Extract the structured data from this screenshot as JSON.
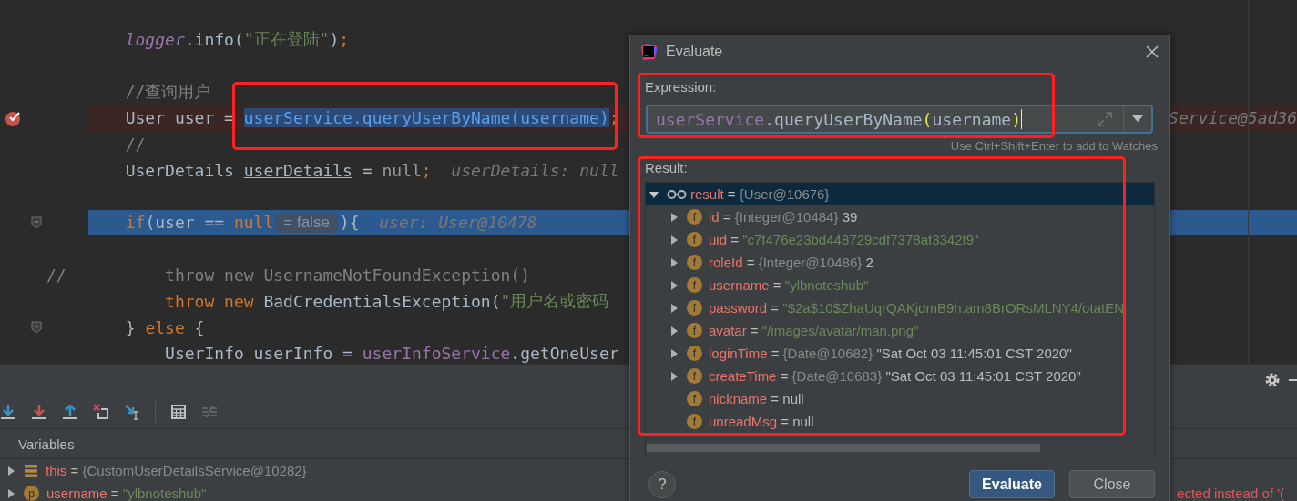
{
  "editor": {
    "lines": [
      {
        "kind": "normal",
        "segments": [
          {
            "kind": "static",
            "text": "        logger"
          },
          {
            "kind": "plain",
            "text": ".info("
          },
          {
            "kind": "string",
            "text": "\"正在登陆\""
          },
          {
            "kind": "plain",
            "text": ")"
          },
          {
            "kind": "punct",
            "text": ";"
          }
        ]
      },
      {
        "kind": "blank"
      },
      {
        "kind": "normal",
        "segments": [
          {
            "kind": "comment",
            "text": "        //查询用户"
          }
        ]
      },
      {
        "kind": "breakpoint",
        "segments": [
          {
            "kind": "plain",
            "text": "        User user = "
          },
          {
            "kind": "selection",
            "text": "userService.queryUserByName(username)",
            "annotated": true
          },
          {
            "kind": "punct",
            "text": ";"
          },
          {
            "kind": "tail",
            "text": "Service@5ad36"
          }
        ]
      },
      {
        "kind": "normal",
        "segments": [
          {
            "kind": "comment",
            "text": "        //"
          }
        ]
      },
      {
        "kind": "normal",
        "segments": [
          {
            "kind": "plain",
            "text": "        UserDetails "
          },
          {
            "kind": "local",
            "text": "userDetails"
          },
          {
            "kind": "plain",
            "text": " = "
          },
          {
            "kind": "nullval",
            "text": "null"
          },
          {
            "kind": "punct",
            "text": ";"
          },
          {
            "kind": "hint",
            "text": "  userDetails: null"
          }
        ]
      },
      {
        "kind": "blank"
      },
      {
        "kind": "current",
        "fold": true,
        "segments": [
          {
            "kind": "keyword",
            "text": "        if"
          },
          {
            "kind": "plain",
            "text": "(user == "
          },
          {
            "kind": "keyword",
            "text": "null"
          },
          {
            "kind": "chip",
            "text": "= false"
          },
          {
            "kind": "plain",
            "text": "){"
          },
          {
            "kind": "hint",
            "text": "  user: User@10478"
          }
        ]
      },
      {
        "kind": "blank"
      },
      {
        "kind": "normal",
        "segments": [
          {
            "kind": "comment",
            "text": "//          throw new UsernameNotFoundException()"
          }
        ]
      },
      {
        "kind": "normal",
        "segments": [
          {
            "kind": "keyword",
            "text": "            throw new"
          },
          {
            "kind": "plain",
            "text": " BadCredentialsException("
          },
          {
            "kind": "string",
            "text": "\"用户名或密码"
          }
        ]
      },
      {
        "kind": "normal",
        "fold": true,
        "segments": [
          {
            "kind": "plain",
            "text": "        } "
          },
          {
            "kind": "keyword",
            "text": "else"
          },
          {
            "kind": "plain",
            "text": " {"
          }
        ]
      },
      {
        "kind": "normal",
        "segments": [
          {
            "kind": "plain",
            "text": "            UserInfo userInfo = "
          },
          {
            "kind": "field",
            "text": "userInfoService"
          },
          {
            "kind": "plain",
            "text": ".getOneUser"
          }
        ]
      }
    ]
  },
  "dialog": {
    "title": "Evaluate",
    "expression_label": "Expression:",
    "expression": [
      {
        "kind": "field",
        "text": "userService"
      },
      {
        "kind": "plain",
        "text": ".queryUserByName"
      },
      {
        "kind": "paren",
        "text": "("
      },
      {
        "kind": "plain",
        "text": "username"
      },
      {
        "kind": "paren",
        "text": ")"
      }
    ],
    "expression_annotated": true,
    "hint": "Use Ctrl+Shift+Enter to add to Watches",
    "result_label": "Result:",
    "result_annotated": true,
    "result": {
      "name": "result",
      "op": "=",
      "value": "{User@10676}",
      "expanded": true,
      "selected": true,
      "children": [
        {
          "kind": "plain",
          "badge": "f",
          "name": "id",
          "op": "=",
          "type": "{Integer@10484}",
          "value": "39",
          "expandable": true
        },
        {
          "kind": "string",
          "badge": "f",
          "name": "uid",
          "op": "=",
          "value": "\"c7f476e23bd448729cdf7378af3342f9\"",
          "expandable": true
        },
        {
          "kind": "plain",
          "badge": "f",
          "name": "roleId",
          "op": "=",
          "type": "{Integer@10486}",
          "value": "2",
          "expandable": true
        },
        {
          "kind": "string",
          "badge": "f",
          "name": "username",
          "op": "=",
          "value": "\"ylbnoteshub\"",
          "expandable": true
        },
        {
          "kind": "string",
          "badge": "f",
          "name": "password",
          "op": "=",
          "value": "\"$2a$10$ZhaUqrQAKjdmB9h.am8BrORsMLNY4/otatEN",
          "expandable": true
        },
        {
          "kind": "string",
          "badge": "f",
          "name": "avatar",
          "op": "=",
          "value": "\"/images/avatar/man.png\"",
          "expandable": true
        },
        {
          "kind": "plain",
          "badge": "f",
          "name": "loginTime",
          "op": "=",
          "type": "{Date@10682}",
          "value": "\"Sat Oct 03 11:45:01 CST 2020\"",
          "expandable": true
        },
        {
          "kind": "plain",
          "badge": "f",
          "name": "createTime",
          "op": "=",
          "type": "{Date@10683}",
          "value": "\"Sat Oct 03 11:45:01 CST 2020\"",
          "expandable": true
        },
        {
          "kind": "plain",
          "badge": "f",
          "name": "nickname",
          "op": "=",
          "value": "null",
          "expandable": false
        },
        {
          "kind": "plain",
          "badge": "f",
          "name": "unreadMsg",
          "op": "=",
          "value": "null",
          "expandable": false
        }
      ]
    },
    "help": "?",
    "buttons": [
      {
        "label": "Evaluate",
        "kind": "primary"
      },
      {
        "label": "Close",
        "kind": "default"
      }
    ]
  },
  "debug_panel": {
    "variables_label": "Variables",
    "variables": [
      {
        "kind": "object",
        "name": "this",
        "op": "=",
        "value": "{CustomUserDetailsService@10282}"
      },
      {
        "kind": "param",
        "badge": "p",
        "name": "username",
        "op": "=",
        "value": "\"ylbnoteshub\""
      }
    ],
    "message": "ected instead of '("
  }
}
